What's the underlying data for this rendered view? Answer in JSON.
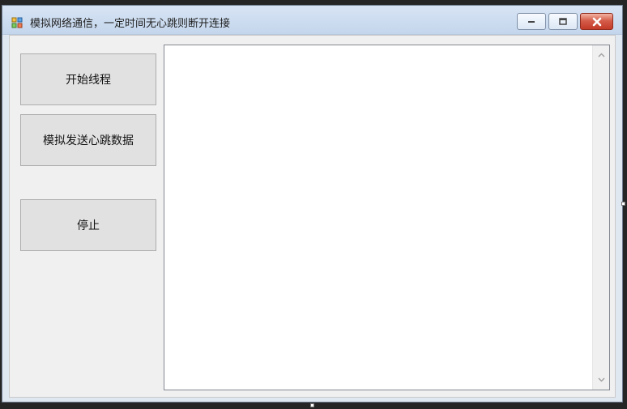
{
  "window": {
    "title": "模拟网络通信，一定时间无心跳则断开连接",
    "controls": {
      "minimize_icon": "minimize-icon",
      "maximize_icon": "maximize-icon",
      "close_icon": "close-icon"
    }
  },
  "buttons": {
    "start_thread": "开始线程",
    "simulate_heartbeat": "模拟发送心跳数据",
    "stop": "停止"
  },
  "log": {
    "content": ""
  },
  "colors": {
    "titlebar_top": "#d7e4f4",
    "titlebar_bottom": "#c4d6ec",
    "close_button": "#c43a28",
    "client_background": "#f0f0f0",
    "button_background": "#e1e1e1"
  },
  "icons": {
    "app_icon": "app-icon",
    "scroll_up": "scroll-up-icon",
    "scroll_down": "scroll-down-icon"
  }
}
